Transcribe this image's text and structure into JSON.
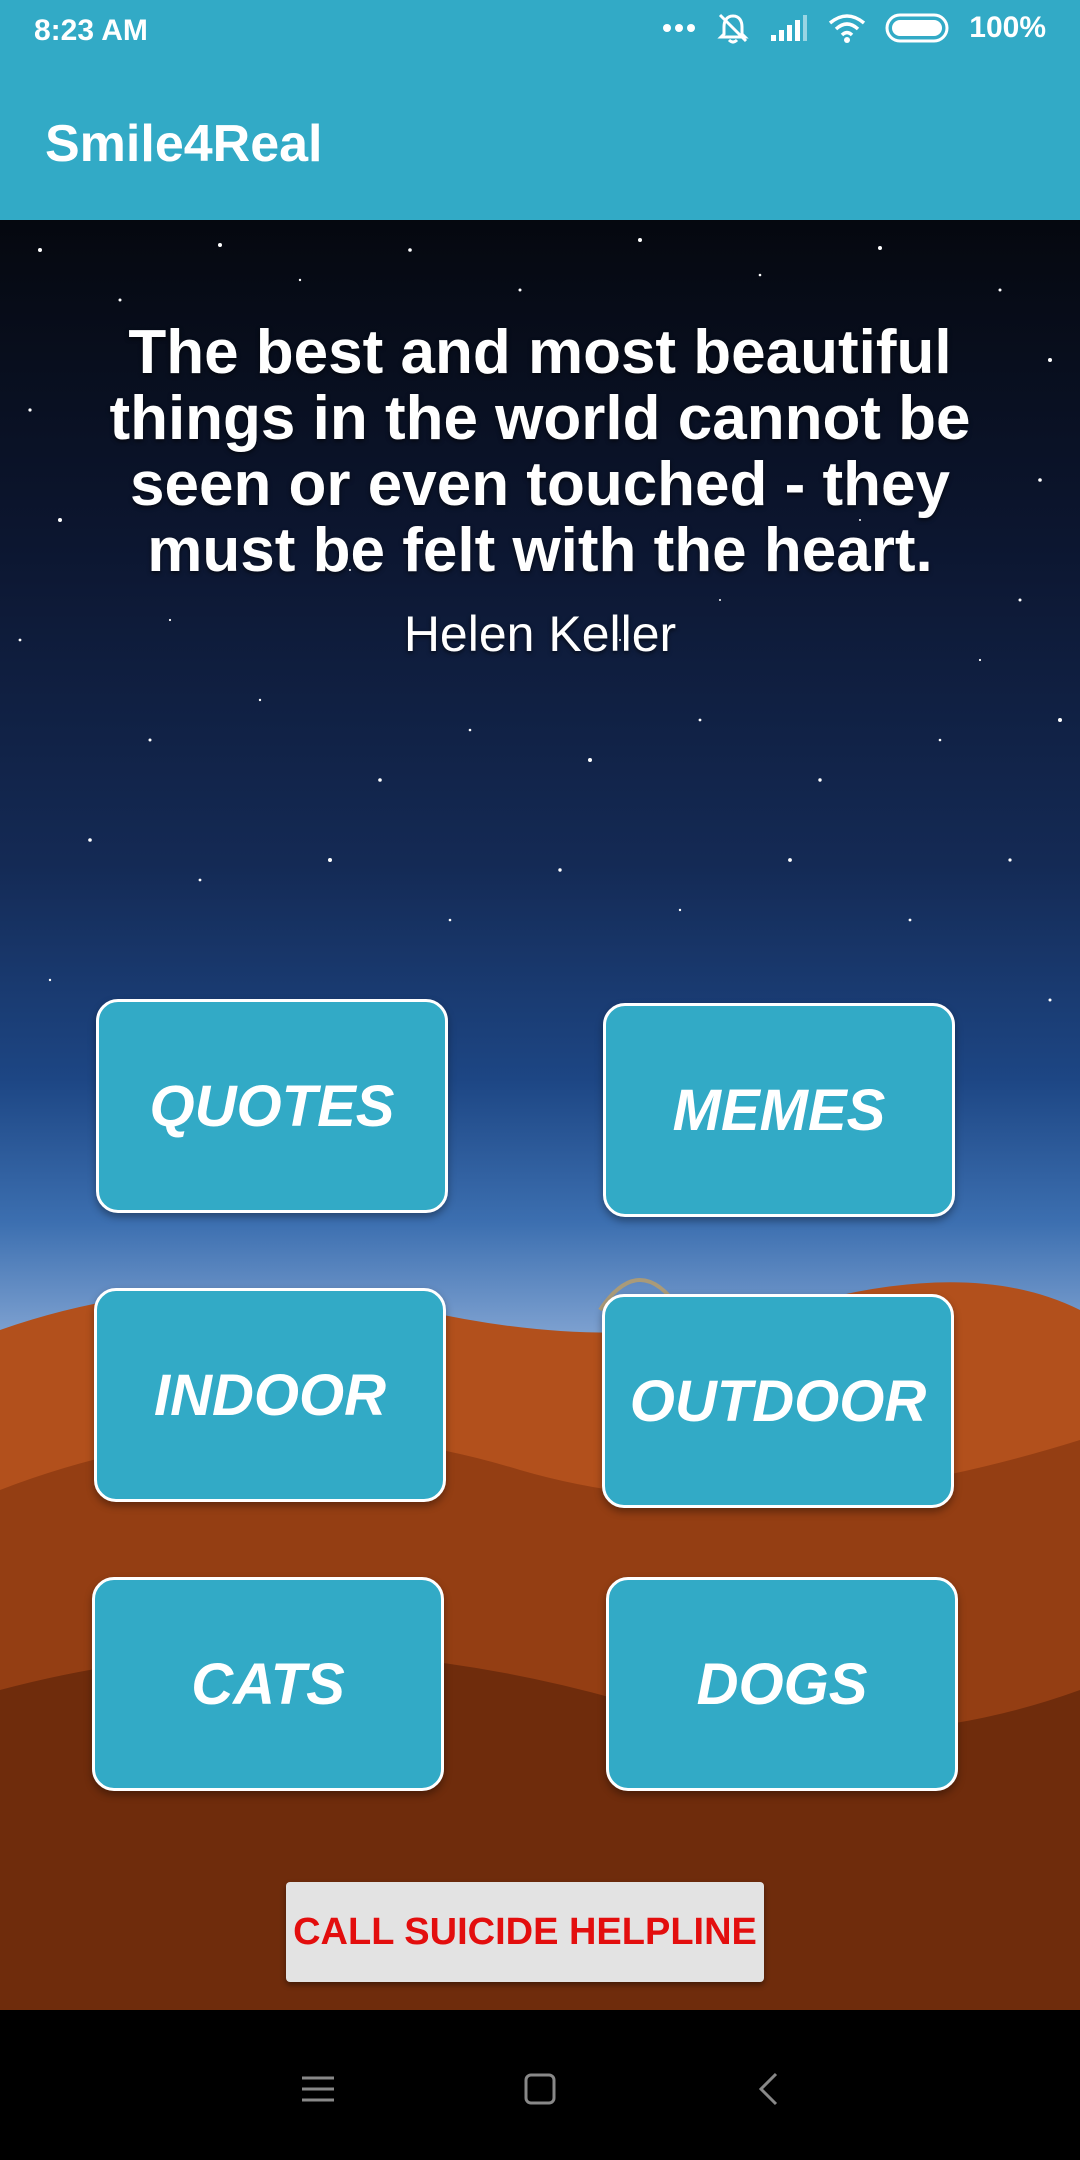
{
  "status_bar": {
    "time": "8:23 AM",
    "battery": "100%",
    "icons": [
      "more-dots-icon",
      "mute-bell-icon",
      "signal-icon",
      "wifi-icon",
      "battery-icon"
    ]
  },
  "app_bar": {
    "title": "Smile4Real"
  },
  "quote": {
    "text": "The best and most beautiful things in the world cannot be seen or even touched - they must be felt with the heart.",
    "author": "Helen Keller"
  },
  "categories": {
    "quotes": "QUOTES",
    "memes": "MEMES",
    "indoor": "INDOOR",
    "outdoor": "OUTDOOR",
    "cats": "CATS",
    "dogs": "DOGS"
  },
  "helpline": {
    "label": "CALL SUICIDE HELPLINE"
  },
  "nav_bar": {
    "icons": [
      "menu-icon",
      "home-square-icon",
      "back-chevron-icon"
    ]
  },
  "colors": {
    "accent": "#32aac6",
    "helpline_text": "#e30e0e",
    "helpline_bg": "#e3e3e3"
  }
}
